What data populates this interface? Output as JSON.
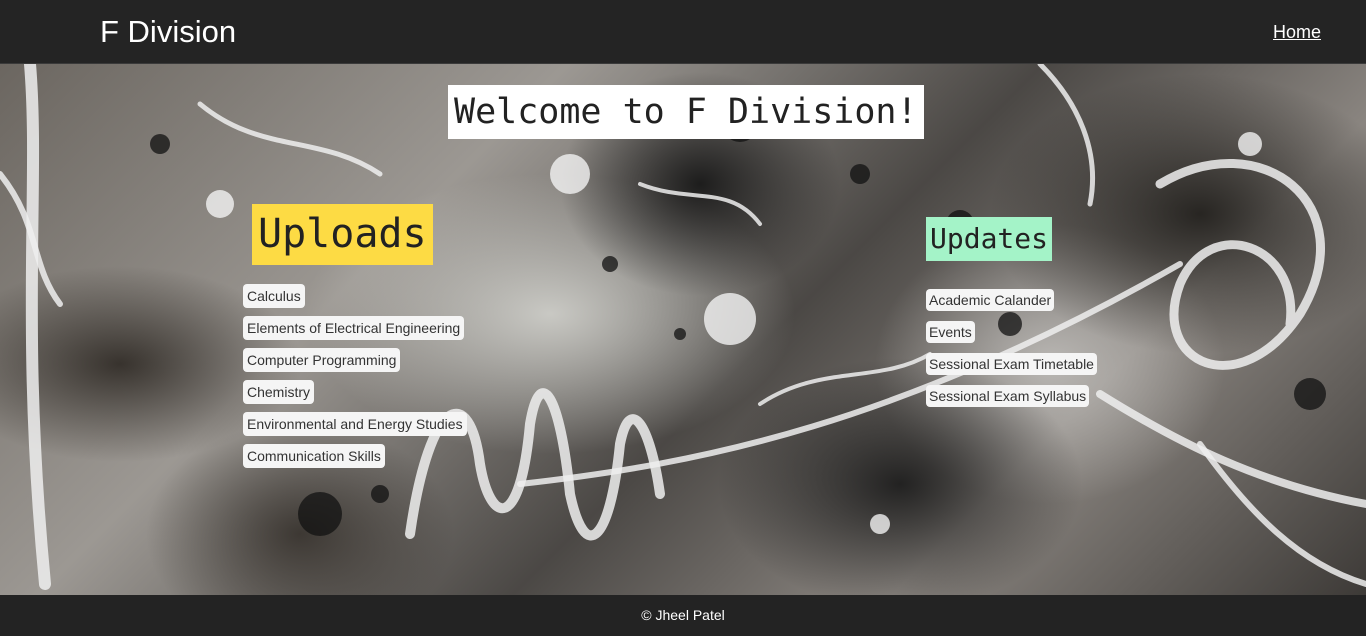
{
  "header": {
    "brand": "F Division",
    "nav": {
      "home_label": "Home"
    }
  },
  "main": {
    "welcome": "Welcome to F Division!",
    "uploads": {
      "title": "Uploads",
      "items": [
        "Calculus",
        "Elements of Electrical Engineering",
        "Computer Programming",
        "Chemistry",
        "Environmental and Energy Studies",
        "Communication Skills"
      ]
    },
    "updates": {
      "title": "Updates",
      "items": [
        "Academic Calander",
        "Events",
        "Sessional Exam Timetable",
        "Sessional Exam Syllabus"
      ]
    }
  },
  "footer": {
    "text": "© Jheel Patel"
  },
  "colors": {
    "header_bg": "#242424",
    "uploads_accent": "#fddb44",
    "updates_accent": "#a4f3c8",
    "footer_bg": "#232323"
  }
}
